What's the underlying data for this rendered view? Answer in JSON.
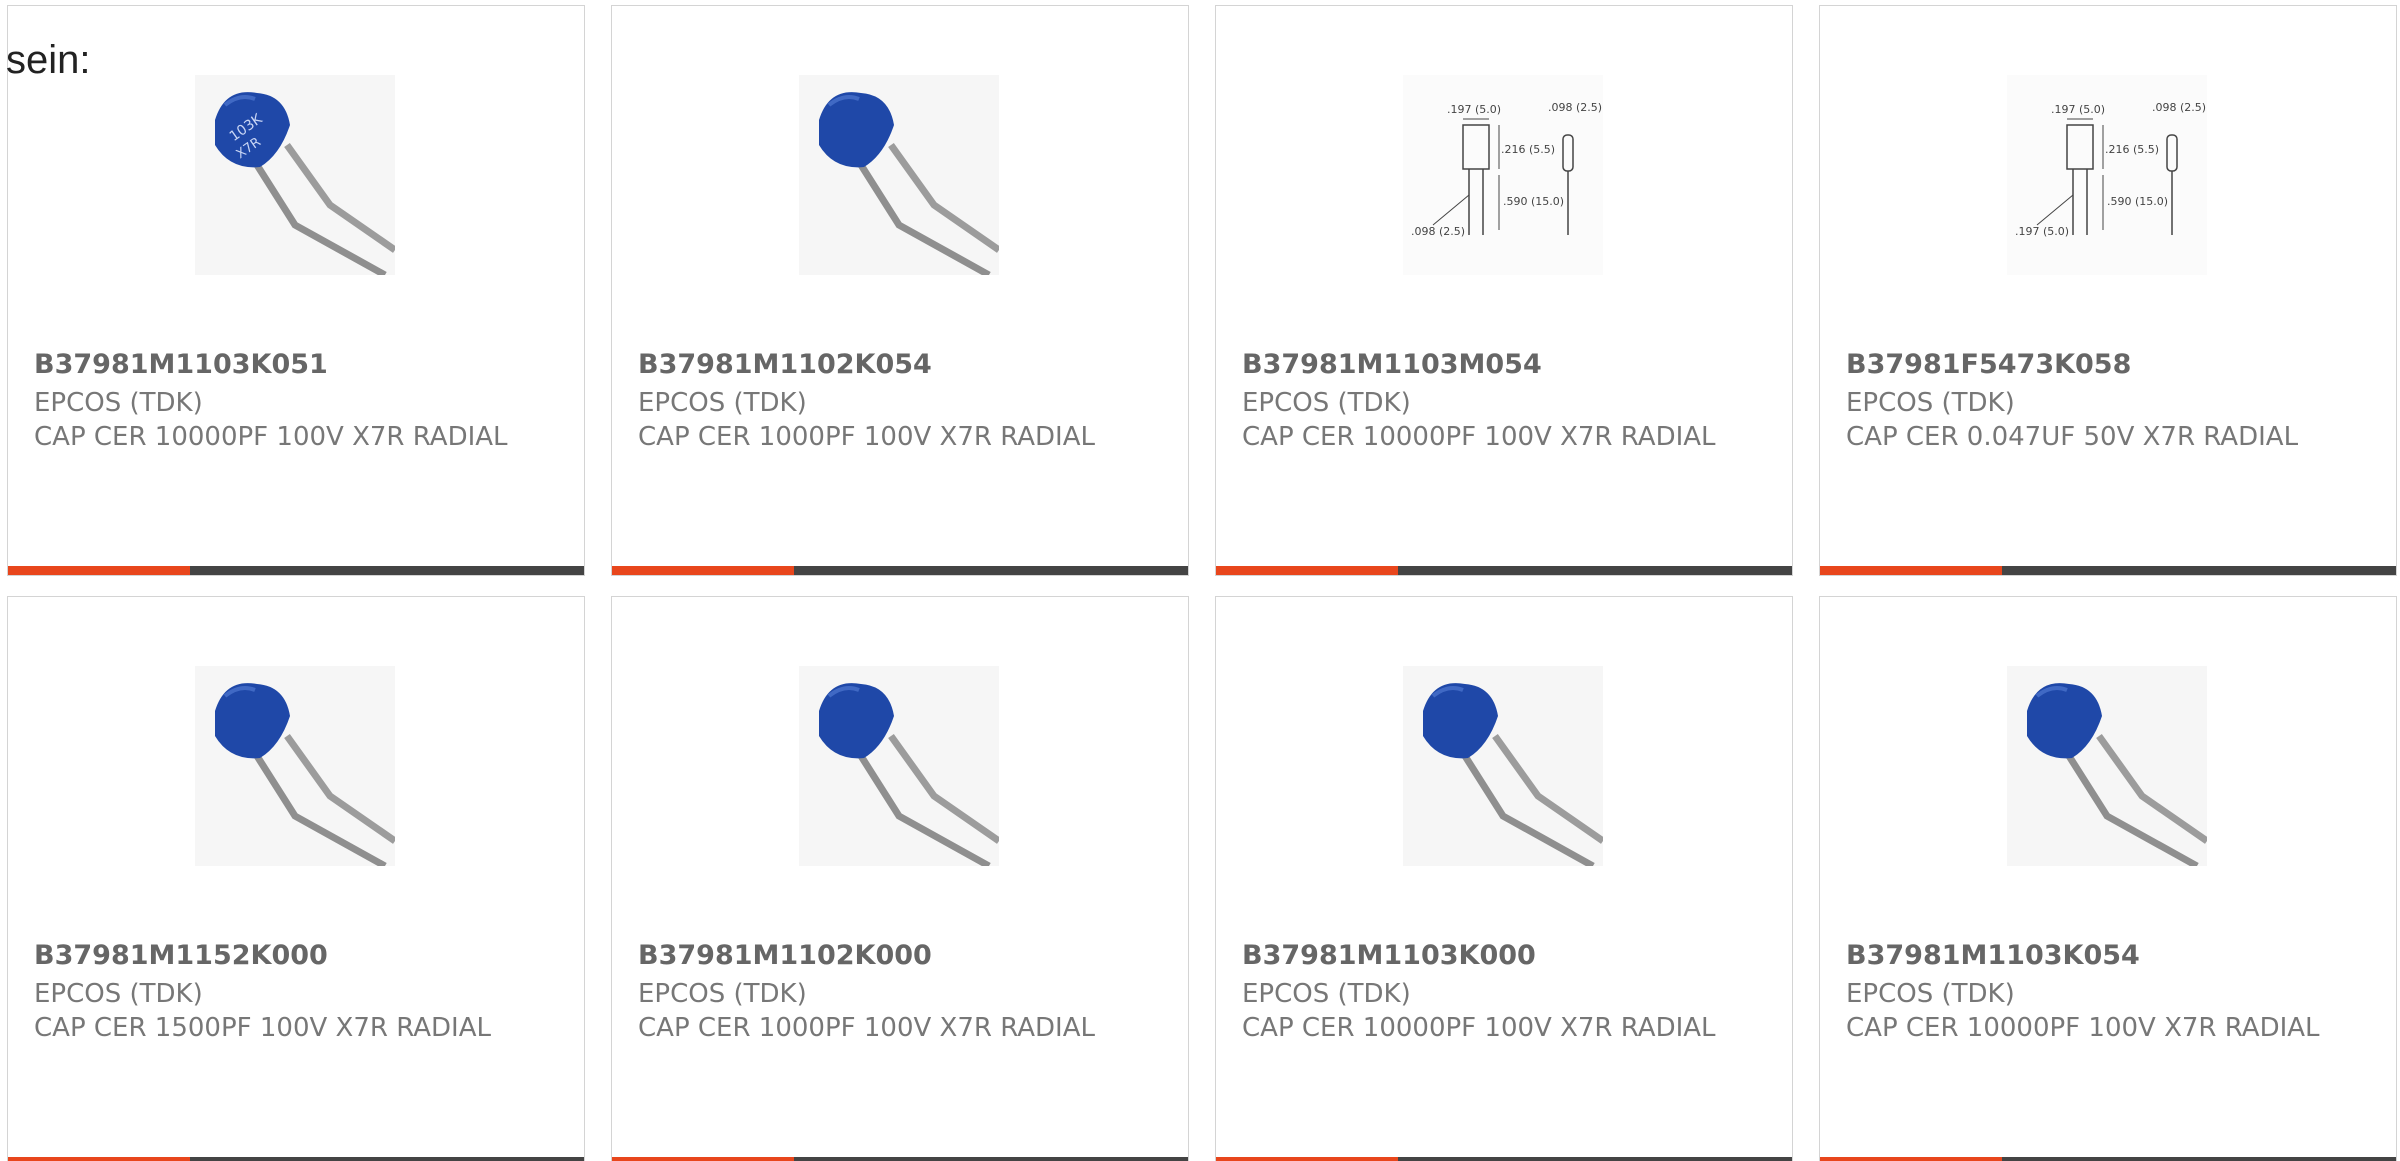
{
  "intro_text": "sein:",
  "colors": {
    "accent": "#e8461c",
    "bar": "#444444",
    "capacitor_blue": "#1f48a8"
  },
  "products": [
    {
      "part_number": "B37981M1103K051",
      "manufacturer": "EPCOS (TDK)",
      "description": "CAP CER 10000PF 100V X7R RADIAL",
      "image": "capacitor-photo-marked-icon"
    },
    {
      "part_number": "B37981M1102K054",
      "manufacturer": "EPCOS (TDK)",
      "description": "CAP CER 1000PF 100V X7R RADIAL",
      "image": "capacitor-photo-icon"
    },
    {
      "part_number": "B37981M1103M054",
      "manufacturer": "EPCOS (TDK)",
      "description": "CAP CER 10000PF 100V X7R RADIAL",
      "image": "dimension-drawing-icon",
      "drawing_labels": [
        ".197 (5.0)",
        ".098 (2.5)",
        ".216 (5.5)",
        ".590 (15.0)",
        ".098 (2.5)"
      ]
    },
    {
      "part_number": "B37981F5473K058",
      "manufacturer": "EPCOS (TDK)",
      "description": "CAP CER 0.047UF 50V X7R RADIAL",
      "image": "dimension-drawing-icon",
      "drawing_labels": [
        ".197 (5.0)",
        ".098 (2.5)",
        ".216 (5.5)",
        ".590 (15.0)",
        ".197 (5.0)"
      ]
    },
    {
      "part_number": "B37981M1152K000",
      "manufacturer": "EPCOS (TDK)",
      "description": "CAP CER 1500PF 100V X7R RADIAL",
      "image": "capacitor-photo-icon"
    },
    {
      "part_number": "B37981M1102K000",
      "manufacturer": "EPCOS (TDK)",
      "description": "CAP CER 1000PF 100V X7R RADIAL",
      "image": "capacitor-photo-icon"
    },
    {
      "part_number": "B37981M1103K000",
      "manufacturer": "EPCOS (TDK)",
      "description": "CAP CER 10000PF 100V X7R RADIAL",
      "image": "capacitor-photo-icon"
    },
    {
      "part_number": "B37981M1103K054",
      "manufacturer": "EPCOS (TDK)",
      "description": "CAP CER 10000PF 100V X7R RADIAL",
      "image": "capacitor-photo-icon"
    }
  ]
}
